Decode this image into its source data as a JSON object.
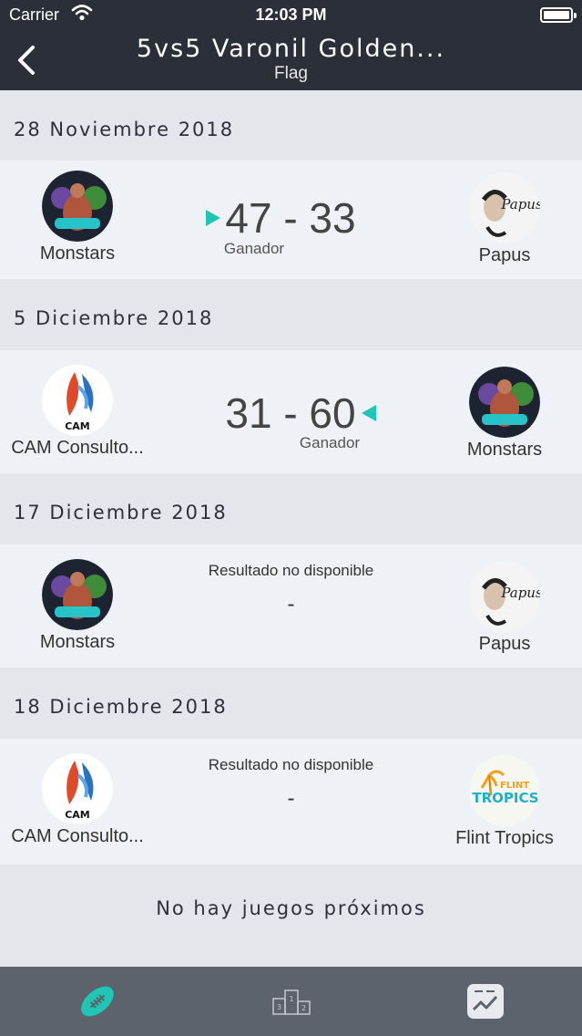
{
  "status_bar": {
    "carrier": "Carrier",
    "time": "12:03 PM"
  },
  "nav": {
    "title": "5vs5 Varonil Golden...",
    "subtitle": "Flag"
  },
  "matches": [
    {
      "date": "28 Noviembre 2018",
      "home": "Monstars",
      "away": "Papus",
      "score": "47 - 33",
      "result_label": "Ganador",
      "winner": "home"
    },
    {
      "date": "5 Diciembre 2018",
      "home": "CAM Consulto...",
      "away": "Monstars",
      "score": "31 - 60",
      "result_label": "Ganador",
      "winner": "away"
    },
    {
      "date": "17 Diciembre 2018",
      "home": "Monstars",
      "away": "Papus",
      "status": "Resultado no disponible",
      "score": "-"
    },
    {
      "date": "18 Diciembre 2018",
      "home": "CAM Consulto...",
      "away": "Flint Tropics",
      "status": "Resultado no disponible",
      "score": "-"
    }
  ],
  "logos": {
    "cam": "CAM",
    "flint_top": "FLINT",
    "flint_bottom": "TROPICS",
    "papus": "Papus"
  },
  "footer_message": "No hay juegos próximos",
  "tabs": [
    {
      "icon": "football-icon",
      "active": true
    },
    {
      "icon": "podium-icon",
      "active": false
    },
    {
      "icon": "stats-chart-icon",
      "active": false
    }
  ],
  "colors": {
    "nav_bg": "#2b3038",
    "accent": "#1fc6b4",
    "tabbar_bg": "#5d636c"
  }
}
